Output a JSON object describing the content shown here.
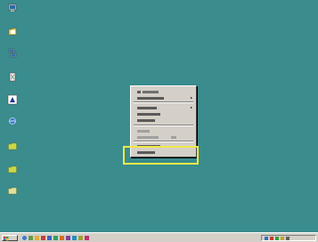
{
  "desktop": {
    "background": "#3a8c8d",
    "icons": [
      {
        "name": "my-computer-icon",
        "label": ""
      },
      {
        "name": "my-documents-icon",
        "label": ""
      },
      {
        "name": "network-icon",
        "label": ""
      },
      {
        "name": "recycle-bin-icon",
        "label": ""
      },
      {
        "name": "program-icon",
        "label": ""
      },
      {
        "name": "internet-explorer-icon",
        "label": ""
      },
      {
        "name": "folder-icon",
        "label": ""
      },
      {
        "name": "folder-icon",
        "label": ""
      },
      {
        "name": "folder-icon",
        "label": ""
      }
    ]
  },
  "context_menu": {
    "items": [
      {
        "label": "",
        "has_submenu": true
      },
      {
        "label": "",
        "has_submenu": true
      },
      {
        "label": "",
        "has_submenu": false
      },
      {
        "label": "",
        "has_submenu": true
      },
      {
        "label": "",
        "has_submenu": false
      },
      {
        "label": "",
        "has_submenu": false
      },
      {
        "label": "",
        "has_submenu": false
      },
      {
        "label": "",
        "has_submenu": false
      },
      {
        "label": "",
        "has_submenu": false
      },
      {
        "label": "",
        "has_submenu": false
      }
    ]
  },
  "highlight": {
    "color": "#f2e84a"
  },
  "taskbar": {
    "start_label": "",
    "clock": ""
  }
}
